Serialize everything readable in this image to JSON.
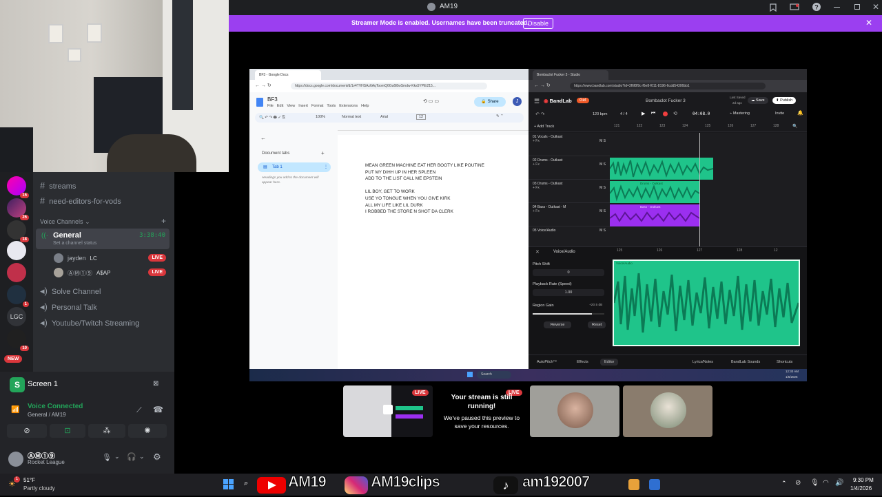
{
  "window": {
    "title": "AM19",
    "banner_text": "Streamer Mode is enabled. Usernames have been truncated.",
    "banner_button": "Disable"
  },
  "sidebar": {
    "guild_badges": [
      "15",
      "25",
      "18",
      "1",
      "10"
    ],
    "guild_lgc": "LGC",
    "guild_new": "NEW",
    "text_channels": [
      "streams",
      "need-editors-for-vods"
    ],
    "voice_header": "Voice Channels",
    "general": {
      "name": "General",
      "timer": "3:38:40",
      "status_placeholder": "Set a channel status"
    },
    "voice_users": [
      {
        "name": "jayden",
        "tag": "LC",
        "live": "LIVE"
      },
      {
        "name": "ⒶⓂ①⑨",
        "tag": "A$AP",
        "live": "LIVE"
      }
    ],
    "voice_channels": [
      "Solve Channel",
      "Personal Talk",
      "Youtube/Twitch Streaming"
    ]
  },
  "screen_panel": {
    "title": "Screen 1",
    "voice_status": "Voice Connected",
    "voice_location": "General / AM19",
    "user_name": "ⒶⓂ①⑨",
    "user_activity": "Rocket League"
  },
  "docs": {
    "tab_title": "BF3 - Google Docs",
    "url": "https://docs.google.com/document/d/1v4TVHSAz6AqToomQ6Gu6l8wSmdw-Kks5YPEi215...",
    "doc_title": "BF3",
    "menu": [
      "File",
      "Edit",
      "View",
      "Insert",
      "Format",
      "Tools",
      "Extensions",
      "Help"
    ],
    "share_label": "Share",
    "zoom": "100%",
    "style": "Normal text",
    "font": "Arial",
    "font_size": "12",
    "doc_tabs_label": "Document tabs",
    "tab1": "Tab 1",
    "tab_hint": "Headings you add to the document will appear here.",
    "lyrics": [
      "MEAN GREEN MACHINE EAT HER BOOTY LIKE POUTINE",
      "PUT MY DIHH UP IN HER SPLEEN",
      "ADD TO THE LIST CALL ME EPSTEIN",
      "",
      "LIL BOY, GET TO WORK",
      "USE YO TONGUE WHEN YOU GIVE KIRK",
      "ALL MY LIFE LIKE LIL DURK",
      "I ROBBED THE STORE N SHOT DA CLERK"
    ]
  },
  "bandlab": {
    "tab_title": "Bombaclot Fucker 3 - Studio",
    "url": "https://www.bandlab.com/studio?id=3f6f8f9c-f6e8-f011-8196-6cdd54306bb1",
    "logo": "BandLab",
    "get_label": "Get",
    "project_title": "Bombaclot Fucker 3",
    "last_saved": "Last Saved",
    "saved_ago": "2d ago",
    "save_label": "Save",
    "publish_label": "Publish",
    "bpm": "120 bpm",
    "time_sig": "4 / 4",
    "time": "04:08.0",
    "mastering": "Mastering",
    "invite": "Invite",
    "add_track": "+ Add Track",
    "ruler": [
      "121",
      "122",
      "123",
      "124",
      "125",
      "126",
      "127",
      "128"
    ],
    "ruler2": [
      "125",
      "126",
      "127",
      "128",
      "12"
    ],
    "tracks": [
      {
        "name": "01 Vocals - Outkast",
        "clip": ""
      },
      {
        "name": "02 Drums - Outkast",
        "clip": ""
      },
      {
        "name": "03 Drums - Outkast",
        "clip": "Drums - Outkast"
      },
      {
        "name": "04 Bass - Outkast - M",
        "clip": "Bass - Outkast"
      },
      {
        "name": "05 Voice/Audio",
        "clip": ""
      }
    ],
    "fx_label": "+ Fx",
    "panel_title": "Voice/Audio",
    "pitch_shift": "Pitch Shift",
    "pitch_value": "0",
    "playback_rate": "Playback Rate (Speed)",
    "playback_value": "1.00",
    "region_gain": "Region Gain",
    "gain_value": "+20.5 dB",
    "reverse": "Reverse",
    "reset": "Reset",
    "region_label": "Voice/Audio",
    "bottom_tabs": [
      "AutoPitch™",
      "Effects",
      "Editor"
    ],
    "bottom_right": [
      "Lyrics/Notes",
      "BandLab Sounds",
      "Shortcuts"
    ]
  },
  "share_taskbar": {
    "search": "Search",
    "time": "12:30 AM",
    "date": "1/5/2026"
  },
  "previews": {
    "live": "LIVE",
    "paused_title": "Your stream is still running!",
    "paused_sub": "We've paused this preview to save your resources."
  },
  "taskbar": {
    "temp": "51°F",
    "weather": "Partly cloudy",
    "weather_badge": "1",
    "overlay_youtube": "AM19",
    "overlay_insta": "AM19clips",
    "overlay_tiktok": "am192007",
    "time": "9:30 PM",
    "date": "1/4/2026"
  },
  "colors": {
    "discord_bg": "#2b2d31",
    "banner": "#9b3ff0",
    "live_red": "#da373c",
    "bandlab_green": "#1fc48a",
    "bass_purple": "#9b2ff0",
    "voice_green": "#23a55a"
  }
}
